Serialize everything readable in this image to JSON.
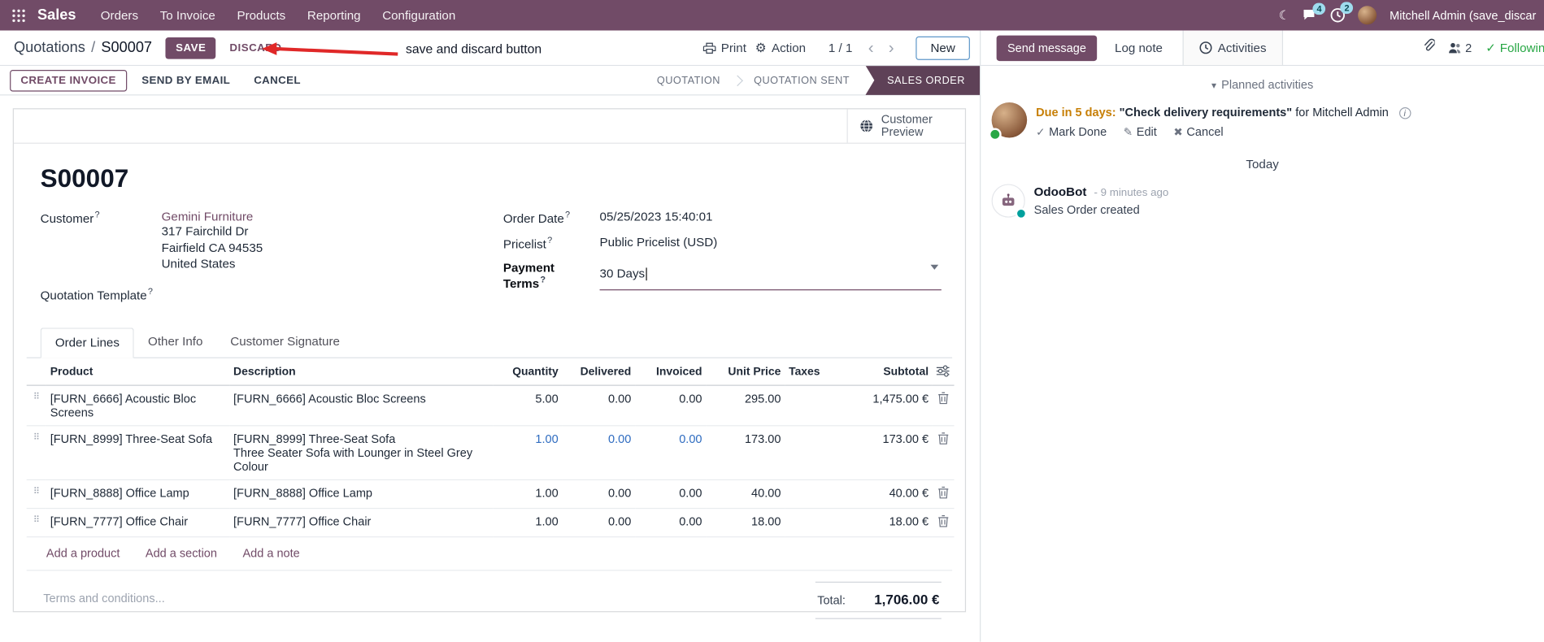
{
  "topbar": {
    "app_name": "Sales",
    "menus": [
      "Orders",
      "To Invoice",
      "Products",
      "Reporting",
      "Configuration"
    ],
    "message_badge": "4",
    "activity_badge": "2",
    "user_name": "Mitchell Admin (save_discar"
  },
  "icons": {
    "moon": "☾",
    "gear": "⚙",
    "prev": "‹",
    "next": "›",
    "drag_handle": "⠿",
    "check": "✓",
    "pencil": "✎",
    "cross": "✖",
    "caret_down": "▾",
    "info": "i"
  },
  "control_panel": {
    "breadcrumb_parent": "Quotations",
    "breadcrumb_separator": "/",
    "breadcrumb_current": "S00007",
    "save_label": "SAVE",
    "discard_label": "DISCARD",
    "annotation": "save and discard button",
    "print_label": "Print",
    "action_label": "Action",
    "pager": "1 / 1",
    "new_label": "New"
  },
  "statusbar": {
    "create_invoice": "CREATE INVOICE",
    "send_by_email": "SEND BY EMAIL",
    "cancel": "CANCEL",
    "stages": [
      "QUOTATION",
      "QUOTATION SENT",
      "SALES ORDER"
    ],
    "active_stage": "SALES ORDER"
  },
  "sheet": {
    "customer_preview": "Customer Preview",
    "title": "S00007",
    "help_marker": "?",
    "fields": {
      "customer_label": "Customer",
      "customer_name": "Gemini Furniture",
      "address_line1": "317 Fairchild Dr",
      "address_line2": "Fairfield CA 94535",
      "address_line3": "United States",
      "quotation_template_label": "Quotation Template",
      "order_date_label": "Order Date",
      "order_date_value": "05/25/2023 15:40:01",
      "pricelist_label": "Pricelist",
      "pricelist_value": "Public Pricelist (USD)",
      "payment_terms_label": "Payment Terms",
      "payment_terms_value": "30 Days"
    },
    "tabs": [
      "Order Lines",
      "Other Info",
      "Customer Signature"
    ],
    "table": {
      "headers": [
        "Product",
        "Description",
        "Quantity",
        "Delivered",
        "Invoiced",
        "Unit Price",
        "Taxes",
        "Subtotal"
      ],
      "rows": [
        {
          "product": "[FURN_6666] Acoustic Bloc Screens",
          "description": "[FURN_6666] Acoustic Bloc Screens",
          "description2": "",
          "quantity": "5.00",
          "delivered": "0.00",
          "invoiced": "0.00",
          "unit_price": "295.00",
          "taxes": "",
          "subtotal": "1,475.00 €"
        },
        {
          "product": "[FURN_8999] Three-Seat Sofa",
          "description": "[FURN_8999] Three-Seat Sofa",
          "description2": "Three Seater Sofa with Lounger in Steel Grey Colour",
          "quantity": "1.00",
          "delivered": "0.00",
          "invoiced": "0.00",
          "unit_price": "173.00",
          "taxes": "",
          "subtotal": "173.00 €"
        },
        {
          "product": "[FURN_8888] Office Lamp",
          "description": "[FURN_8888] Office Lamp",
          "description2": "",
          "quantity": "1.00",
          "delivered": "0.00",
          "invoiced": "0.00",
          "unit_price": "40.00",
          "taxes": "",
          "subtotal": "40.00 €"
        },
        {
          "product": "[FURN_7777] Office Chair",
          "description": "[FURN_7777] Office Chair",
          "description2": "",
          "quantity": "1.00",
          "delivered": "0.00",
          "invoiced": "0.00",
          "unit_price": "18.00",
          "taxes": "",
          "subtotal": "18.00 €"
        }
      ],
      "add_product": "Add a product",
      "add_section": "Add a section",
      "add_note": "Add a note"
    },
    "terms_placeholder": "Terms and conditions...",
    "total_label": "Total:",
    "total_value": "1,706.00 €"
  },
  "chatter": {
    "send_message": "Send message",
    "log_note": "Log note",
    "activities_tab": "Activities",
    "followers_count": "2",
    "following_label": "Following",
    "planned_header": "Planned activities",
    "activity": {
      "due": "Due in 5 days:",
      "summary": "\"Check delivery requirements\"",
      "assignee": "for Mitchell Admin",
      "mark_done": "Mark Done",
      "edit": "Edit",
      "cancel": "Cancel"
    },
    "date_divider": "Today",
    "message": {
      "author": "OdooBot",
      "meta": "- 9 minutes ago",
      "body": "Sales Order created"
    }
  },
  "colors": {
    "brand": "#714B67",
    "active_stage_bg": "#5e4157",
    "link": "#714B67",
    "modified_value": "#2f6cc0",
    "due_warning": "#c77f06",
    "following_green": "#28a745",
    "annotation_red": "#e02828"
  }
}
